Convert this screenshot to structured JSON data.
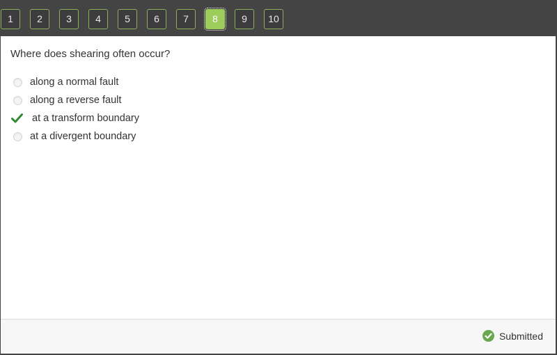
{
  "navigation": {
    "questions": [
      {
        "label": "1",
        "active": false
      },
      {
        "label": "2",
        "active": false
      },
      {
        "label": "3",
        "active": false
      },
      {
        "label": "4",
        "active": false
      },
      {
        "label": "5",
        "active": false
      },
      {
        "label": "6",
        "active": false
      },
      {
        "label": "7",
        "active": false
      },
      {
        "label": "8",
        "active": true
      },
      {
        "label": "9",
        "active": false
      },
      {
        "label": "10",
        "active": false
      }
    ]
  },
  "question": {
    "text": "Where does shearing often occur?",
    "options": [
      {
        "label": "along a normal fault",
        "selected": false,
        "icon": "radio-empty"
      },
      {
        "label": "along a reverse fault",
        "selected": false,
        "icon": "radio-empty"
      },
      {
        "label": "at a transform boundary",
        "selected": true,
        "icon": "checkmark-icon"
      },
      {
        "label": "at a divergent boundary",
        "selected": false,
        "icon": "radio-empty"
      }
    ]
  },
  "footer": {
    "status_icon": "check-circle-icon",
    "status_text": "Submitted"
  },
  "colors": {
    "accent_green": "#9ccc5a",
    "nav_border": "#8fb05a",
    "check_green": "#2e8b2e",
    "status_green": "#6aa84f",
    "topbar_bg": "#444444"
  }
}
